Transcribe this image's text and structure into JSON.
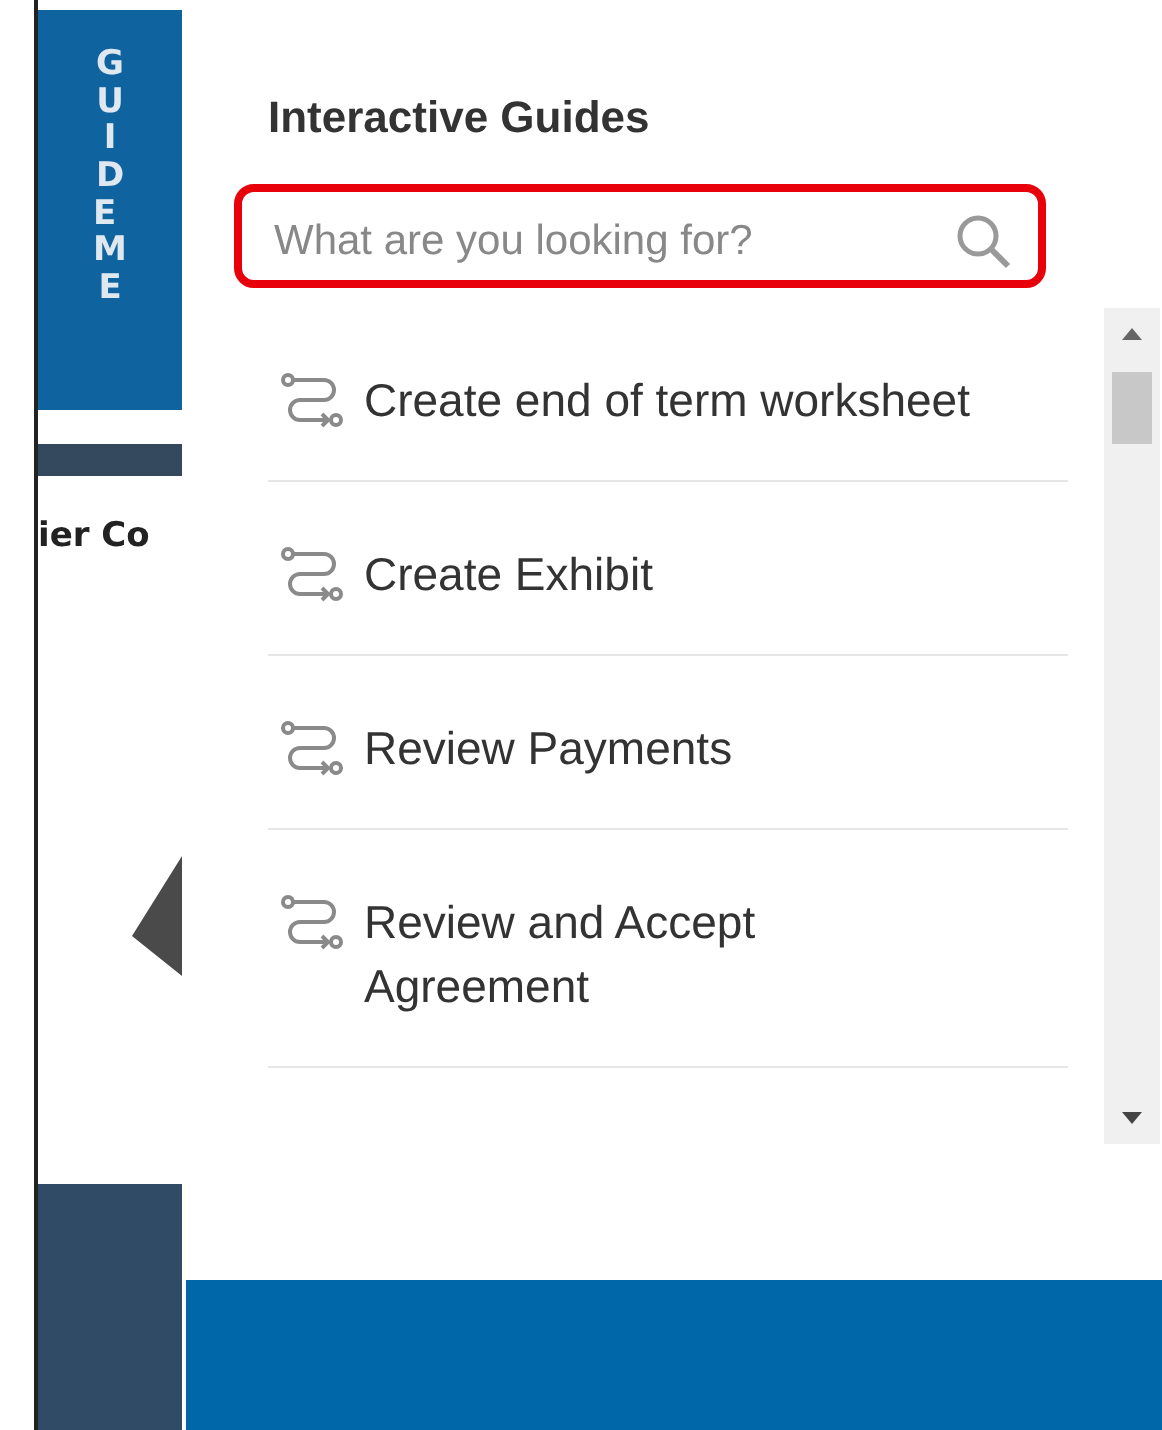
{
  "guide_tab": {
    "label": "GUIDE ME"
  },
  "background": {
    "heading_fragment": "ier Co"
  },
  "panel": {
    "title": "Interactive Guides",
    "search": {
      "placeholder": "What are you looking for?"
    },
    "guides": [
      {
        "label": "Create end of term worksheet"
      },
      {
        "label": "Create Exhibit"
      },
      {
        "label": "Review Payments"
      },
      {
        "label": "Review and Accept Agreement"
      }
    ]
  }
}
